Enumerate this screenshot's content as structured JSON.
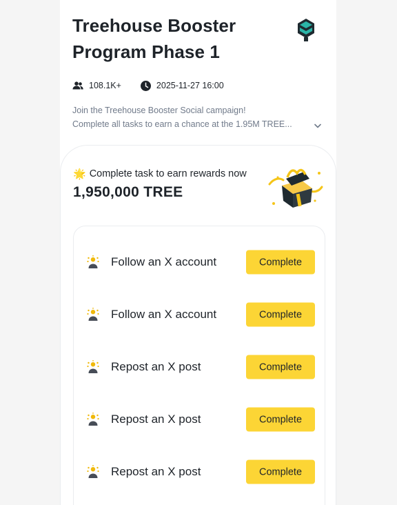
{
  "campaign": {
    "title": "Treehouse Booster Program Phase 1",
    "participants": "108.1K+",
    "end_time": "2025-11-27 16:00",
    "description_line1": "Join the Treehouse Booster Social campaign!",
    "description_line2": "Complete all tasks to earn a chance at the 1.95M TREE..."
  },
  "rewards": {
    "label": "Complete task to earn rewards now",
    "amount": "1,950,000 TREE"
  },
  "tasks": [
    {
      "label": "Follow an X account",
      "button": "Complete"
    },
    {
      "label": "Follow an X account",
      "button": "Complete"
    },
    {
      "label": "Repost an X post",
      "button": "Complete"
    },
    {
      "label": "Repost an X post",
      "button": "Complete"
    },
    {
      "label": "Repost an X post",
      "button": "Complete"
    }
  ],
  "icons": {
    "logo": "treehouse-logo",
    "participants": "users-icon",
    "time": "clock-icon",
    "expand": "chevron-down-icon",
    "sun": "sun-emoji-icon",
    "gift": "gift-box-illustration",
    "task": "task-person-icon"
  },
  "colors": {
    "accent": "#fcd535",
    "text": "#1e2329",
    "muted": "#707a8a",
    "logo_teal": "#2bb5a8"
  }
}
